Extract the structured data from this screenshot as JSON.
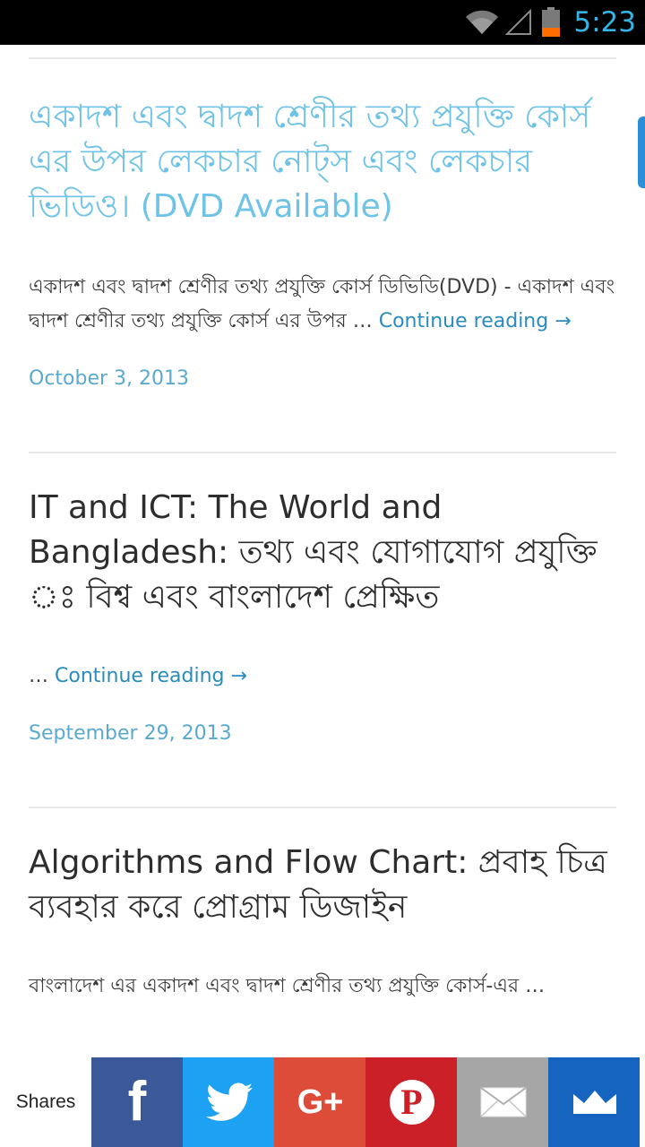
{
  "status_bar": {
    "time": "5:23"
  },
  "posts": [
    {
      "title": "একাদশ এবং দ্বাদশ শ্রেণীর তথ্য প্রযুক্তি কোর্স এর উপর লেকচার নোট্স এবং লেকচার ভিডিও। (DVD Available)",
      "excerpt": "একাদশ এবং দ্বাদশ শ্রেণীর তথ্য প্রযুক্তি কোর্স ডিভিডি(DVD) - একাদশ এবং দ্বাদশ শ্রেণীর তথ্য প্রযুক্তি কোর্স এর উপর … ",
      "more": "Continue reading →",
      "date": "October 3, 2013"
    },
    {
      "title": "IT and ICT: The World and Bangladesh: তথ্য এবং যোগাযোগ প্রযুক্তি ঃ বিশ্ব এবং বাংলাদেশ প্রেক্ষিত",
      "excerpt": "… ",
      "more": "Continue reading →",
      "date": "September 29, 2013"
    },
    {
      "title": "Algorithms and Flow Chart: প্রবাহ চিত্র ব্যবহার করে প্রোগ্রাম ডিজাইন",
      "excerpt": "বাংলাদেশ এর একাদশ এবং দ্বাদশ শ্রেণীর তথ্য প্রযুক্তি কোর্স-এর …"
    }
  ],
  "share_bar": {
    "label": "Shares",
    "buttons": [
      {
        "name": "facebook",
        "color": "#3b5998",
        "glyph": "f"
      },
      {
        "name": "twitter",
        "color": "#1da1f2"
      },
      {
        "name": "google-plus",
        "color": "#dd4b39",
        "glyph": "G+"
      },
      {
        "name": "pinterest",
        "color": "#cb2027",
        "glyph": "P"
      },
      {
        "name": "email",
        "color": "#a6a6a6"
      },
      {
        "name": "sumo",
        "color": "#1565c0"
      }
    ]
  }
}
